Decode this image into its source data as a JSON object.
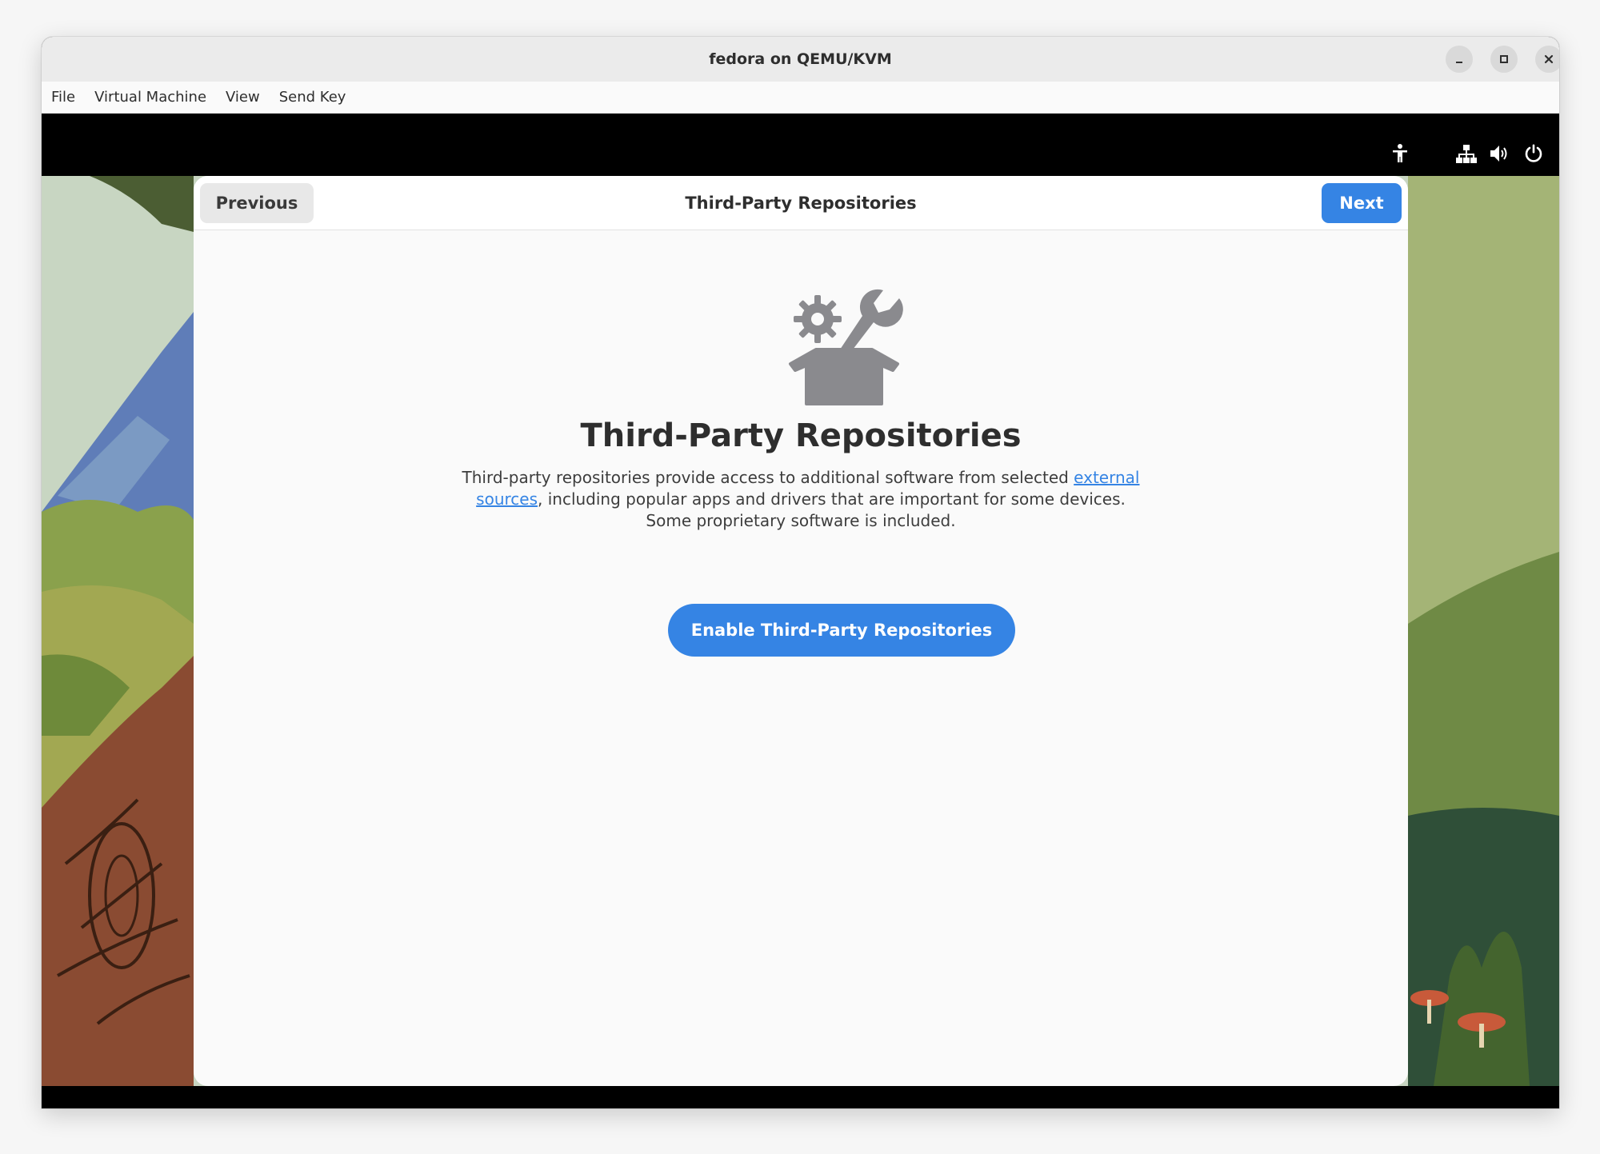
{
  "window": {
    "title": "fedora on QEMU/KVM",
    "controls": [
      "minimize-icon",
      "maximize-icon",
      "close-icon"
    ]
  },
  "menubar": {
    "items": [
      "File",
      "Virtual Machine",
      "View",
      "Send Key"
    ]
  },
  "system_panel": {
    "icons": [
      "accessibility-icon",
      "network-icon",
      "volume-icon",
      "power-icon"
    ]
  },
  "dialog": {
    "header": {
      "title": "Third-Party Repositories",
      "previous_label": "Previous",
      "next_label": "Next"
    },
    "icon": "gear-wrench-box-icon",
    "heading": "Third-Party Repositories",
    "description": {
      "before_link": "Third-party repositories provide access to additional software from selected ",
      "link_text": "external sources",
      "after_link": ", including popular apps and drivers that are important for some devices. Some proprietary software is included."
    },
    "enable_label": "Enable Third-Party Repositories"
  },
  "colors": {
    "accent": "#3584e4",
    "icon_gray": "#8a8a8e",
    "dialog_bg": "#fafafa"
  }
}
